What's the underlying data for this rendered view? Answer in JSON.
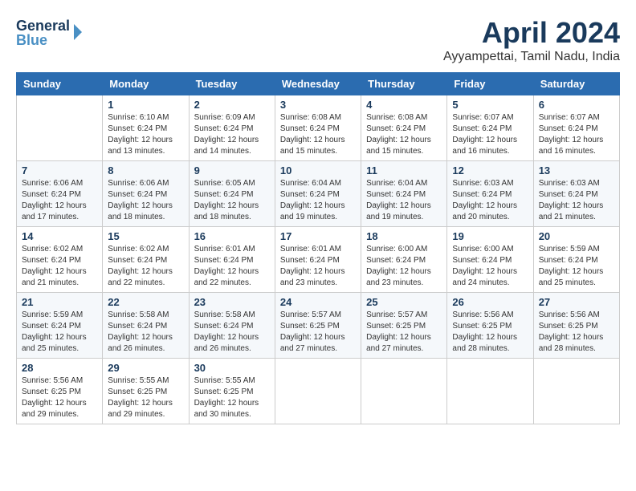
{
  "header": {
    "logo_line1": "General",
    "logo_line2": "Blue",
    "month_title": "April 2024",
    "location": "Ayyampettai, Tamil Nadu, India"
  },
  "days_of_week": [
    "Sunday",
    "Monday",
    "Tuesday",
    "Wednesday",
    "Thursday",
    "Friday",
    "Saturday"
  ],
  "weeks": [
    [
      {
        "day": "",
        "info": ""
      },
      {
        "day": "1",
        "info": "Sunrise: 6:10 AM\nSunset: 6:24 PM\nDaylight: 12 hours\nand 13 minutes."
      },
      {
        "day": "2",
        "info": "Sunrise: 6:09 AM\nSunset: 6:24 PM\nDaylight: 12 hours\nand 14 minutes."
      },
      {
        "day": "3",
        "info": "Sunrise: 6:08 AM\nSunset: 6:24 PM\nDaylight: 12 hours\nand 15 minutes."
      },
      {
        "day": "4",
        "info": "Sunrise: 6:08 AM\nSunset: 6:24 PM\nDaylight: 12 hours\nand 15 minutes."
      },
      {
        "day": "5",
        "info": "Sunrise: 6:07 AM\nSunset: 6:24 PM\nDaylight: 12 hours\nand 16 minutes."
      },
      {
        "day": "6",
        "info": "Sunrise: 6:07 AM\nSunset: 6:24 PM\nDaylight: 12 hours\nand 16 minutes."
      }
    ],
    [
      {
        "day": "7",
        "info": "Sunrise: 6:06 AM\nSunset: 6:24 PM\nDaylight: 12 hours\nand 17 minutes."
      },
      {
        "day": "8",
        "info": "Sunrise: 6:06 AM\nSunset: 6:24 PM\nDaylight: 12 hours\nand 18 minutes."
      },
      {
        "day": "9",
        "info": "Sunrise: 6:05 AM\nSunset: 6:24 PM\nDaylight: 12 hours\nand 18 minutes."
      },
      {
        "day": "10",
        "info": "Sunrise: 6:04 AM\nSunset: 6:24 PM\nDaylight: 12 hours\nand 19 minutes."
      },
      {
        "day": "11",
        "info": "Sunrise: 6:04 AM\nSunset: 6:24 PM\nDaylight: 12 hours\nand 19 minutes."
      },
      {
        "day": "12",
        "info": "Sunrise: 6:03 AM\nSunset: 6:24 PM\nDaylight: 12 hours\nand 20 minutes."
      },
      {
        "day": "13",
        "info": "Sunrise: 6:03 AM\nSunset: 6:24 PM\nDaylight: 12 hours\nand 21 minutes."
      }
    ],
    [
      {
        "day": "14",
        "info": "Sunrise: 6:02 AM\nSunset: 6:24 PM\nDaylight: 12 hours\nand 21 minutes."
      },
      {
        "day": "15",
        "info": "Sunrise: 6:02 AM\nSunset: 6:24 PM\nDaylight: 12 hours\nand 22 minutes."
      },
      {
        "day": "16",
        "info": "Sunrise: 6:01 AM\nSunset: 6:24 PM\nDaylight: 12 hours\nand 22 minutes."
      },
      {
        "day": "17",
        "info": "Sunrise: 6:01 AM\nSunset: 6:24 PM\nDaylight: 12 hours\nand 23 minutes."
      },
      {
        "day": "18",
        "info": "Sunrise: 6:00 AM\nSunset: 6:24 PM\nDaylight: 12 hours\nand 23 minutes."
      },
      {
        "day": "19",
        "info": "Sunrise: 6:00 AM\nSunset: 6:24 PM\nDaylight: 12 hours\nand 24 minutes."
      },
      {
        "day": "20",
        "info": "Sunrise: 5:59 AM\nSunset: 6:24 PM\nDaylight: 12 hours\nand 25 minutes."
      }
    ],
    [
      {
        "day": "21",
        "info": "Sunrise: 5:59 AM\nSunset: 6:24 PM\nDaylight: 12 hours\nand 25 minutes."
      },
      {
        "day": "22",
        "info": "Sunrise: 5:58 AM\nSunset: 6:24 PM\nDaylight: 12 hours\nand 26 minutes."
      },
      {
        "day": "23",
        "info": "Sunrise: 5:58 AM\nSunset: 6:24 PM\nDaylight: 12 hours\nand 26 minutes."
      },
      {
        "day": "24",
        "info": "Sunrise: 5:57 AM\nSunset: 6:25 PM\nDaylight: 12 hours\nand 27 minutes."
      },
      {
        "day": "25",
        "info": "Sunrise: 5:57 AM\nSunset: 6:25 PM\nDaylight: 12 hours\nand 27 minutes."
      },
      {
        "day": "26",
        "info": "Sunrise: 5:56 AM\nSunset: 6:25 PM\nDaylight: 12 hours\nand 28 minutes."
      },
      {
        "day": "27",
        "info": "Sunrise: 5:56 AM\nSunset: 6:25 PM\nDaylight: 12 hours\nand 28 minutes."
      }
    ],
    [
      {
        "day": "28",
        "info": "Sunrise: 5:56 AM\nSunset: 6:25 PM\nDaylight: 12 hours\nand 29 minutes."
      },
      {
        "day": "29",
        "info": "Sunrise: 5:55 AM\nSunset: 6:25 PM\nDaylight: 12 hours\nand 29 minutes."
      },
      {
        "day": "30",
        "info": "Sunrise: 5:55 AM\nSunset: 6:25 PM\nDaylight: 12 hours\nand 30 minutes."
      },
      {
        "day": "",
        "info": ""
      },
      {
        "day": "",
        "info": ""
      },
      {
        "day": "",
        "info": ""
      },
      {
        "day": "",
        "info": ""
      }
    ]
  ]
}
